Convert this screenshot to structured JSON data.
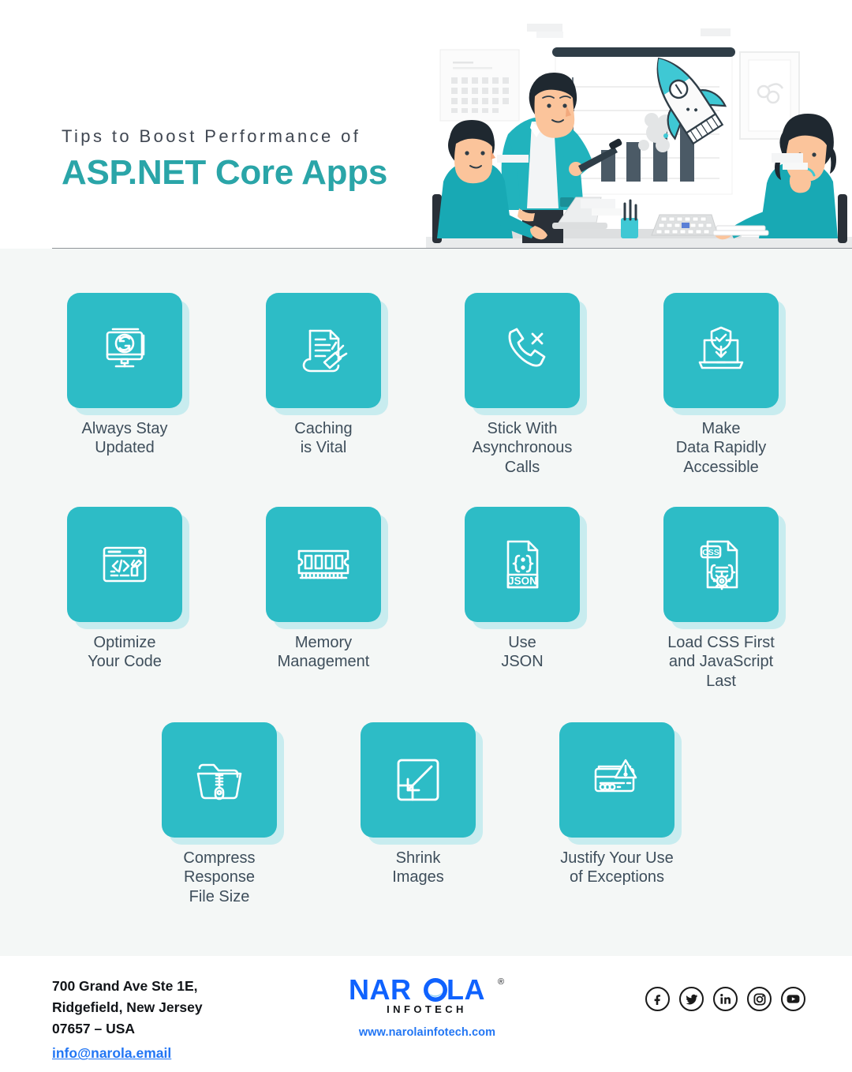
{
  "header": {
    "subtitle": "Tips to Boost Performance of",
    "title": "ASP.NET Core Apps",
    "accent_color": "#2aa5a8",
    "illustration": "team-presentation-rocket-growth-chart"
  },
  "theme": {
    "card_color": "#2dbcc6",
    "card_shadow_color": "#c8ecef",
    "body_background": "#f4f7f6",
    "label_color": "#3e4e5b",
    "link_color": "#2276f4"
  },
  "tips": [
    {
      "label": "Always Stay\nUpdated",
      "icon": "monitor-refresh-icon",
      "row": 1,
      "col": 1
    },
    {
      "label": "Caching\nis Vital",
      "icon": "document-broom-icon",
      "row": 1,
      "col": 2
    },
    {
      "label": "Stick With\nAsynchronous\nCalls",
      "icon": "phone-call-cancel-icon",
      "row": 1,
      "col": 3
    },
    {
      "label": "Make\nData Rapidly\nAccessible",
      "icon": "laptop-shield-download-icon",
      "row": 1,
      "col": 4
    },
    {
      "label": "Optimize\nYour Code",
      "icon": "code-window-wrench-icon",
      "row": 2,
      "col": 1
    },
    {
      "label": "Memory\nManagement",
      "icon": "ram-memory-stick-icon",
      "row": 2,
      "col": 2
    },
    {
      "label": "Use\nJSON",
      "icon": "json-file-icon",
      "row": 2,
      "col": 3
    },
    {
      "label": "Load CSS First\nand JavaScript\nLast",
      "icon": "css-file-gear-icon",
      "row": 2,
      "col": 4
    },
    {
      "label": "Compress\nResponse\nFile Size",
      "icon": "zip-folder-icon",
      "row": 3,
      "col": 1
    },
    {
      "label": "Shrink\nImages",
      "icon": "resize-shrink-arrow-icon",
      "row": 3,
      "col": 2
    },
    {
      "label": "Justify Your Use\nof Exceptions",
      "icon": "card-warning-icon",
      "row": 3,
      "col": 3
    }
  ],
  "footer": {
    "address_line1": "700 Grand Ave Ste 1E,",
    "address_line2": "Ridgefield, New Jersey",
    "address_line3": "07657 – USA",
    "email": "info@narola.email",
    "logo_name": "NAROLA",
    "logo_sub": "INFOTECH",
    "logo_trademark": "®",
    "website": "www.narolainfotech.com",
    "socials": [
      {
        "name": "facebook-icon",
        "label": "Facebook"
      },
      {
        "name": "twitter-icon",
        "label": "Twitter"
      },
      {
        "name": "linkedin-icon",
        "label": "LinkedIn"
      },
      {
        "name": "instagram-icon",
        "label": "Instagram"
      },
      {
        "name": "youtube-icon",
        "label": "YouTube"
      }
    ]
  }
}
